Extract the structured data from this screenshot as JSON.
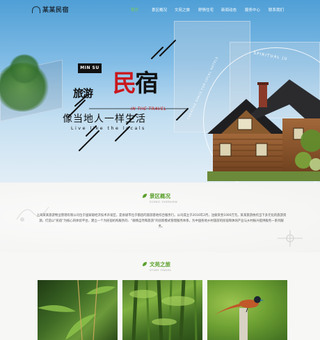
{
  "brand": {
    "logo_text": "某某民宿"
  },
  "nav": {
    "items": [
      {
        "label": "首页",
        "active": true
      },
      {
        "label": "景区概况",
        "active": false
      },
      {
        "label": "文苑之旅",
        "active": false
      },
      {
        "label": "舒情住宅",
        "active": false
      },
      {
        "label": "新闻动态",
        "active": false
      },
      {
        "label": "服务中心",
        "active": false
      },
      {
        "label": "联系我们",
        "active": false
      }
    ]
  },
  "hero": {
    "badge": "MIN SU",
    "side_title": "旅游",
    "title_black": "民",
    "title_red": "宿",
    "subtitle_en": "IN THE TRAVEL",
    "slogan": "像当地人一样生活",
    "slogan_en": "Live like the locals",
    "circle_text_top": "SPIRITUAL JU",
    "circle_text_side": "CREATIVE SPACE FOR LOCAL HOTELS"
  },
  "about": {
    "title": "景区概况",
    "subtitle": "SCENIC OVERVIEW",
    "body": "上海某某旅游物业管理有限公司位于国家级经济技术开发区，是县级市位于都昌的旅游基地综合服务行。公司成立于2016年2月，注册资金1000万元。某某旅游依托当下多元化的旅游资源，打造以“民宿”为核心的体验平台，建立一个为民宿机构服务的、“融情自然和旅游”的创新模式管理服务体系，为中国各地乡村旅游的民宿和休闲产业与乡村振兴提供服务一系列服务。"
  },
  "travel": {
    "title": "文苑之旅",
    "subtitle": "STUDY TRAVEL"
  },
  "colors": {
    "accent_green": "#5aa02c",
    "accent_red": "#c9181e",
    "nav_active": "#7ccc4f"
  }
}
